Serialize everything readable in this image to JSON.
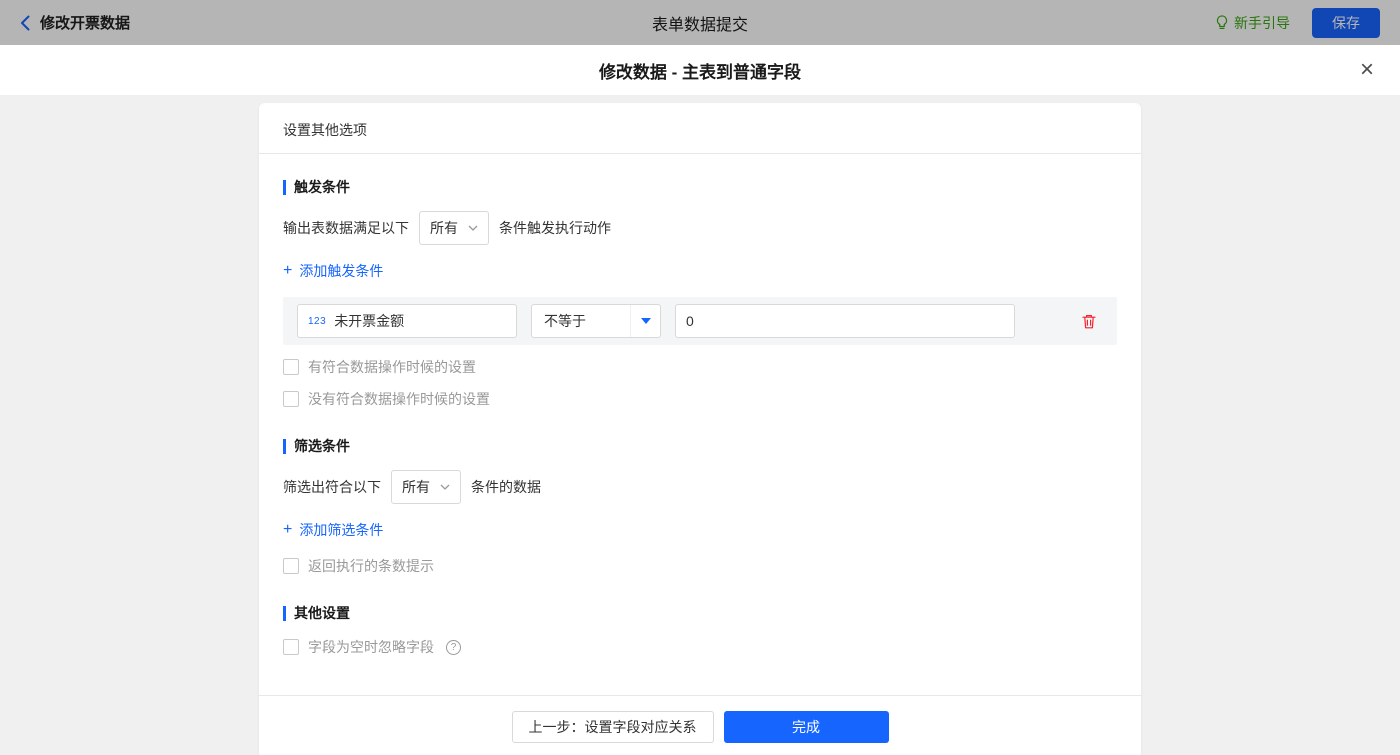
{
  "topbar": {
    "back_label": "修改开票数据",
    "title": "表单数据提交",
    "guide_label": "新手引导",
    "save_label": "保存"
  },
  "modal": {
    "title": "修改数据 - 主表到普通字段"
  },
  "icons": {
    "close": "×",
    "plus": "+",
    "help": "?",
    "field_type_number": "123"
  },
  "card": {
    "header_title": "设置其他选项",
    "trigger": {
      "title": "触发条件",
      "sentence_prefix": "输出表数据满足以下",
      "match_select": "所有",
      "sentence_suffix": "条件触发执行动作",
      "add_link": "添加触发条件",
      "condition": {
        "field": "未开票金额",
        "operator": "不等于",
        "value": "0"
      },
      "checkbox_has_match": "有符合数据操作时候的设置",
      "checkbox_no_match": "没有符合数据操作时候的设置"
    },
    "filter": {
      "title": "筛选条件",
      "sentence_prefix": "筛选出符合以下",
      "match_select": "所有",
      "sentence_suffix": "条件的数据",
      "add_link": "添加筛选条件",
      "checkbox_count_tip": "返回执行的条数提示"
    },
    "other": {
      "title": "其他设置",
      "checkbox_ignore_empty": "字段为空时忽略字段"
    },
    "footer": {
      "prev_button": "上一步：设置字段对应关系",
      "done_button": "完成"
    }
  },
  "colors": {
    "accent": "#1765ff",
    "guide_green": "#3aa514",
    "danger": "#f5222d",
    "topbar_dim": "#b5b5b5",
    "row_bg": "#f4f5f7"
  }
}
